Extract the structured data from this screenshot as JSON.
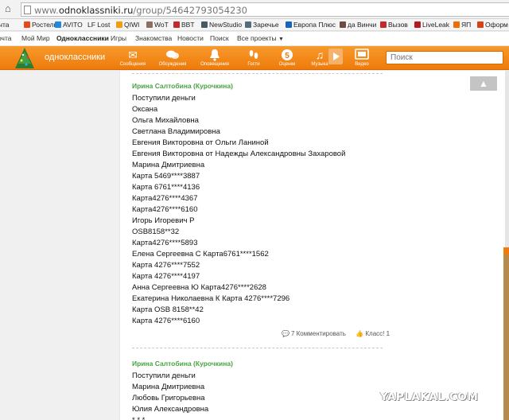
{
  "browser": {
    "url_prefix": "www.",
    "url_domain": "odnoklassniki.ru",
    "url_path": "/group/54642793054230"
  },
  "bookmarks": [
    {
      "label": "очта",
      "color": "transparent"
    },
    {
      "label": "Ростелк",
      "color": "#e64a19"
    },
    {
      "label": "AVITO",
      "color": "#1e88e5"
    },
    {
      "label": "LF Lost",
      "color": "#7cb342"
    },
    {
      "label": "QIWI",
      "color": "#f39c12"
    },
    {
      "label": "WoT",
      "color": "#8d6e63"
    },
    {
      "label": "BBT",
      "color": "#c62828"
    },
    {
      "label": "NewStudio",
      "color": "#455a64"
    },
    {
      "label": "Заречье",
      "color": "#546e7a"
    },
    {
      "label": "Европа Плюс",
      "color": "#1565c0"
    },
    {
      "label": "да Винчи",
      "color": "#6d4c41"
    },
    {
      "label": "Вызов",
      "color": "#c62828"
    },
    {
      "label": "LiveLeak",
      "color": "#b71c1c"
    },
    {
      "label": "ЯП",
      "color": "#ef6c00"
    },
    {
      "label": "Оформ",
      "color": "#d84315"
    }
  ],
  "topnav": [
    {
      "label": "очта",
      "active": false
    },
    {
      "label": "Мой Мир",
      "active": false
    },
    {
      "label": "Одноклассники",
      "active": true
    },
    {
      "label": "Игры",
      "active": false
    },
    {
      "label": "Знакомства",
      "active": false
    },
    {
      "label": "Новости",
      "active": false
    },
    {
      "label": "Поиск",
      "active": false
    },
    {
      "label": "Все проекты",
      "active": false
    }
  ],
  "header": {
    "brand": "одноклассники",
    "nav": [
      {
        "label": "Сообщения",
        "icon": "envelope-icon",
        "glyph": "✉"
      },
      {
        "label": "Обсуждения",
        "icon": "chat-bubbles-icon",
        "glyph": "💬"
      },
      {
        "label": "Оповещения",
        "icon": "bell-icon",
        "glyph": "🔔"
      },
      {
        "label": "Гости",
        "icon": "footprints-icon",
        "glyph": "👣"
      },
      {
        "label": "Оценки",
        "icon": "rating-icon",
        "glyph": "5"
      },
      {
        "label": "Музыка",
        "icon": "music-note-icon",
        "glyph": "♫"
      },
      {
        "label": "Видео",
        "icon": "video-icon",
        "glyph": "▭"
      }
    ],
    "search_placeholder": "Поиск"
  },
  "posts": [
    {
      "author": "Ирина Салтобина (Курочкина)",
      "lines": [
        "Поступили деньги",
        "Оксана",
        "Ольга Михайловна",
        "Светлана Владимировна",
        "Евгения Викторовна от Ольги Ланиной",
        "Евгения Викторовна от Надежды Александровны Захаровой",
        "Марина Дмитриевна",
        "Карта 5469****3887",
        "Карта 6761****4136",
        "Карта4276****4367",
        "Карта4276****6160",
        "Игорь Игоревич Р",
        "OSB8158**32",
        "Карта4276****5893",
        "Елена Сергеевна С Карта6761****1562",
        "Карта 4276****7552",
        "Карта 4276****4197",
        "Анна Сергеевна Ю Карта4276****2628",
        "Екатерина Николаевна К Карта 4276****7296",
        "Карта OSB 8158**42",
        "Карта 4276****6160"
      ],
      "comments_label": "7 Комментировать",
      "likes_label": "Класс! 1"
    },
    {
      "author": "Ирина Салтобина (Курочкина)",
      "lines": [
        "Поступили деньги",
        "Марина Дмитриевна",
        "Любовь Григорьевна",
        "Юлия Александровна",
        "* * *"
      ]
    }
  ],
  "scroll_up_glyph": "▲",
  "watermark": "YAPLAKAL.COM"
}
